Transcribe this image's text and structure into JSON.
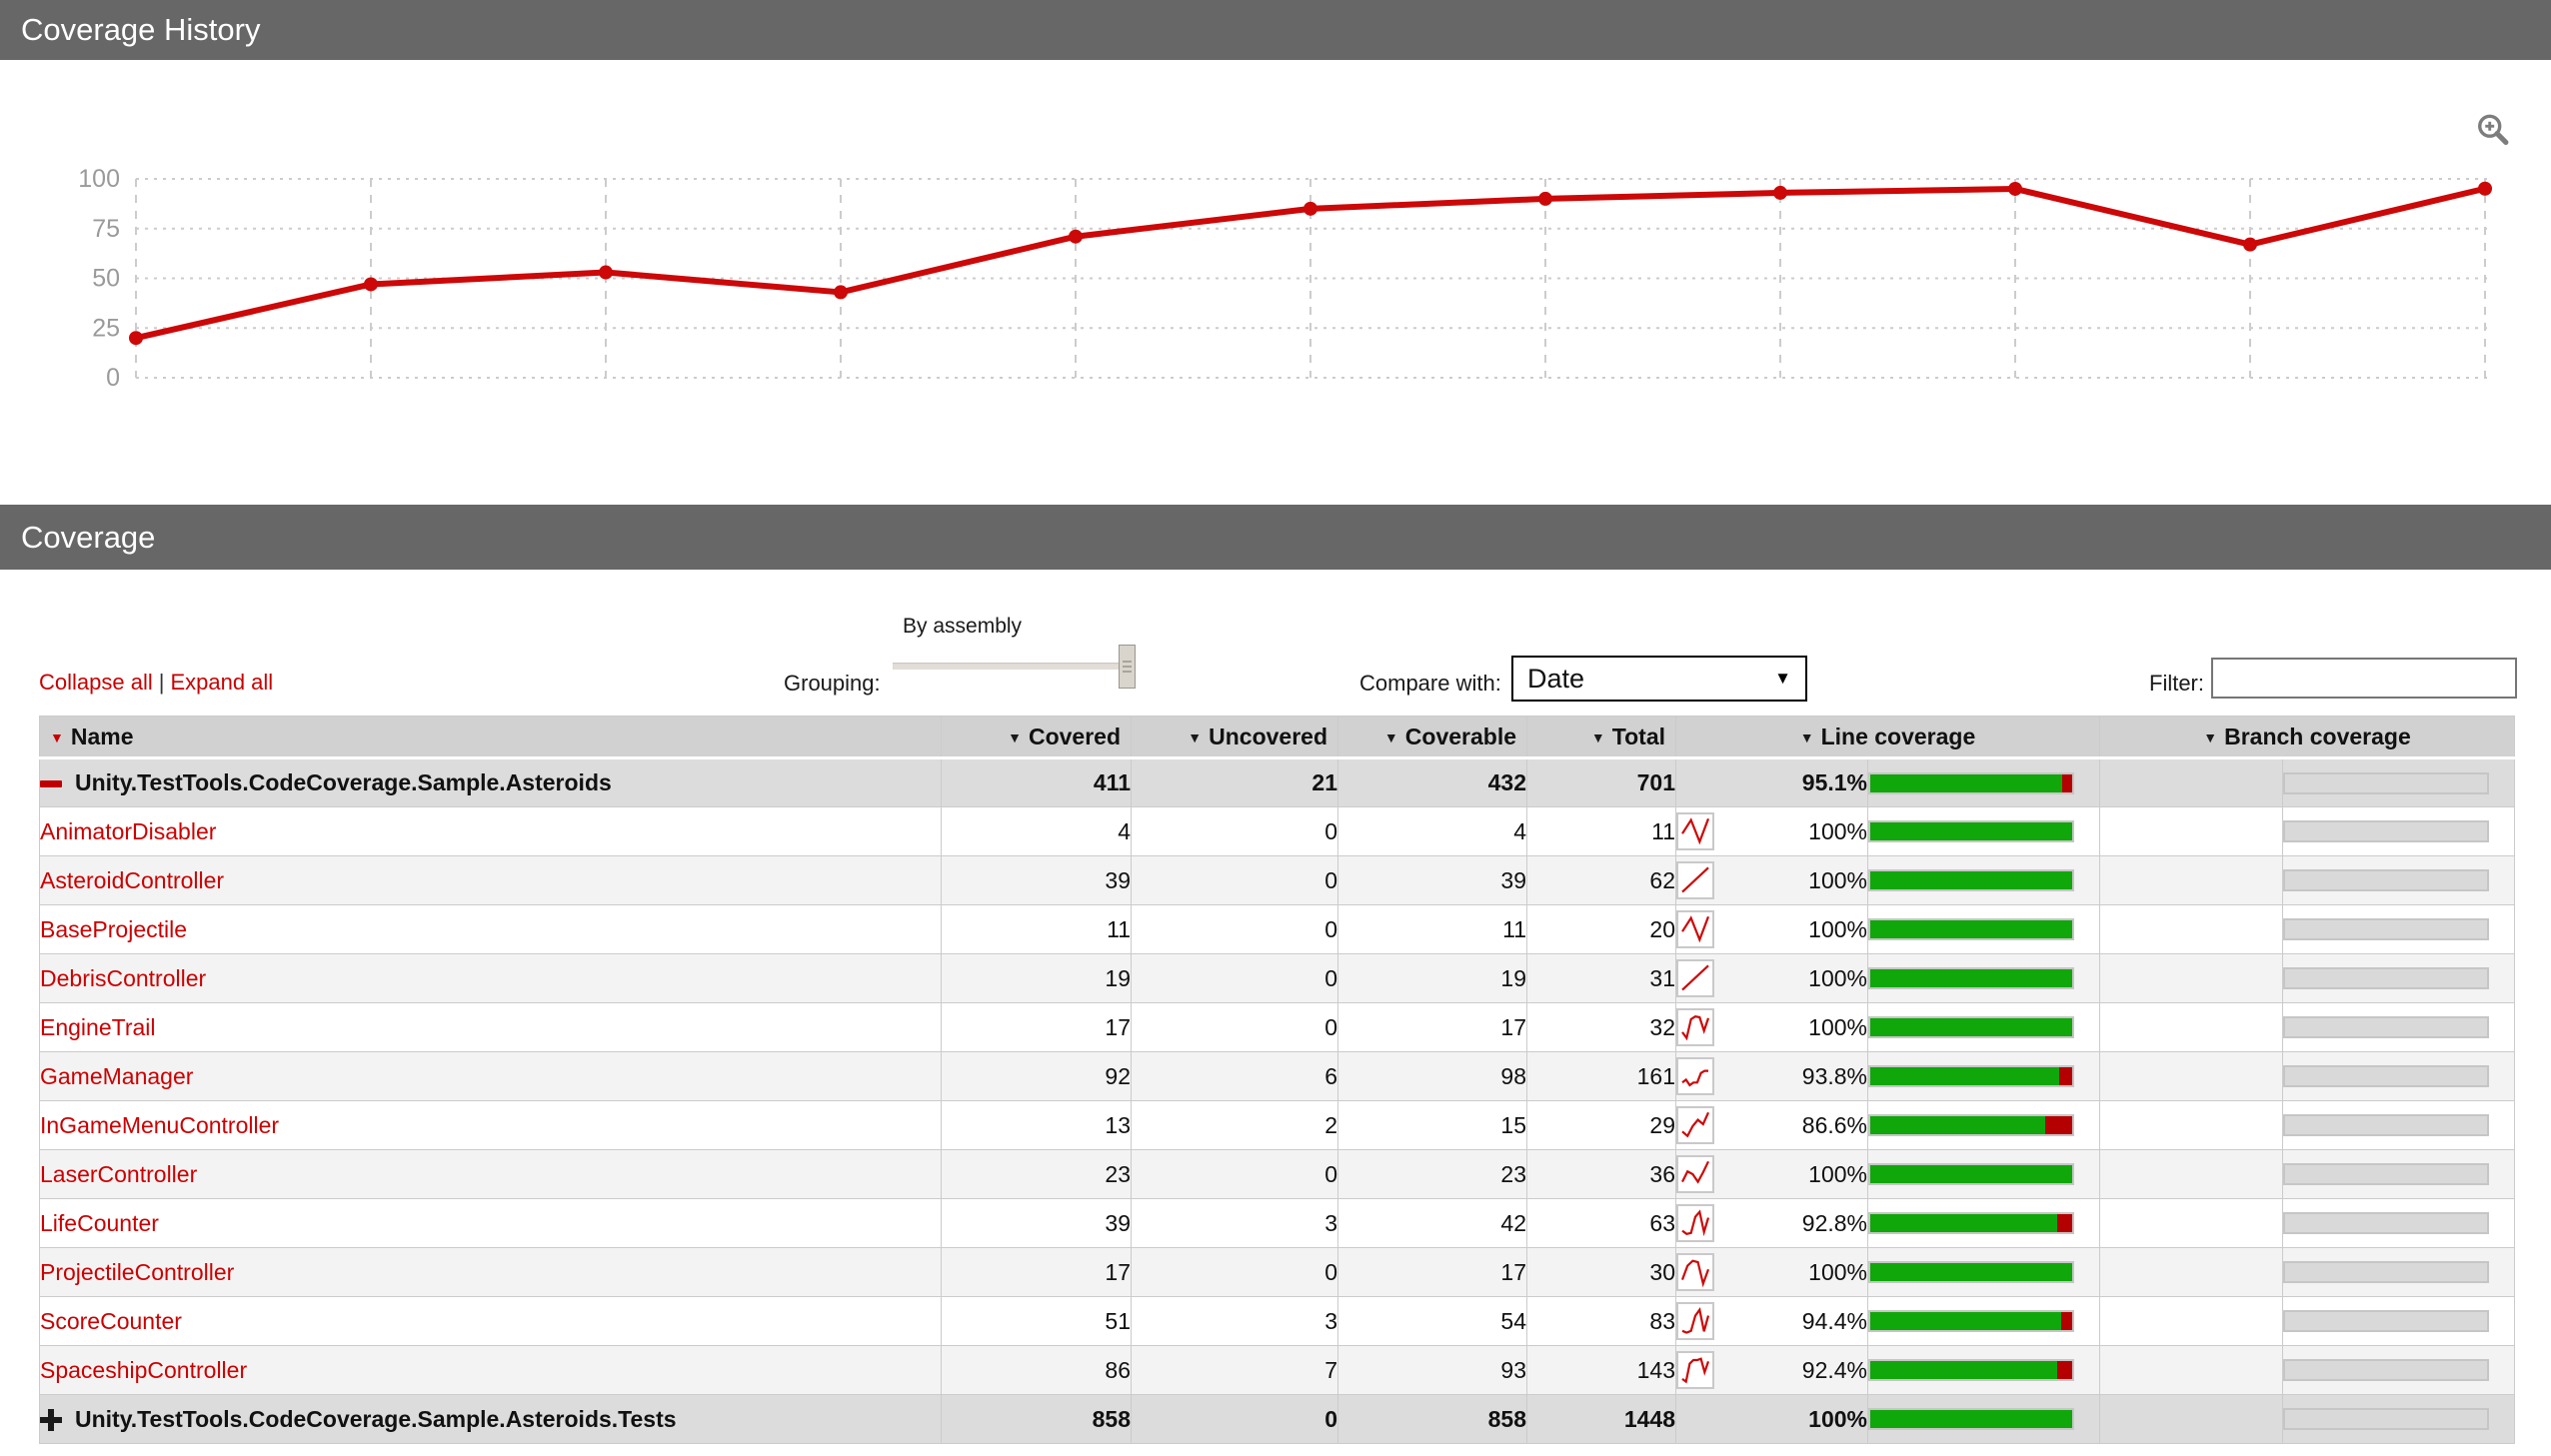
{
  "headers": {
    "history_title": "Coverage History",
    "coverage_title": "Coverage"
  },
  "chart_data": {
    "type": "line",
    "title": "Coverage History",
    "x": [
      1,
      2,
      3,
      4,
      5,
      6,
      7,
      8,
      9,
      10,
      11
    ],
    "series": [
      {
        "name": "Line coverage %",
        "values": [
          20,
          47,
          53,
          43,
          71,
          85,
          90,
          93,
          95,
          67,
          95.1
        ]
      }
    ],
    "ylim": [
      0,
      100
    ],
    "yticks": [
      "0",
      "25",
      "50",
      "75",
      "100"
    ],
    "grid": true,
    "legend": "none"
  },
  "icons": {
    "zoom": "magnifier-plus-icon",
    "collapse": "minus-icon",
    "expand": "plus-icon",
    "sort": "triangle-down-icon",
    "select_arrow": "triangle-down-icon"
  },
  "colors": {
    "header_gray": "#676767",
    "accent_red": "#cc0000",
    "chart_line": "#cc0808",
    "bar_green": "#10a70a",
    "bar_red": "#b40000",
    "branch_fill": "#d9d9d9",
    "grid_line": "#cccccc",
    "axis_label": "#9a9a9a"
  },
  "controls": {
    "collapse_all": "Collapse all",
    "separator": "|",
    "expand_all": "Expand all",
    "grouping_label": "Grouping:",
    "grouping_value": "By assembly",
    "compare_label": "Compare with:",
    "compare_value": "Date",
    "select_arrow": "▼",
    "filter_label": "Filter:",
    "filter_value": ""
  },
  "table": {
    "headers": [
      "Name",
      "Covered",
      "Uncovered",
      "Coverable",
      "Total",
      "Line coverage",
      "Branch coverage"
    ],
    "rows": [
      {
        "type": "assembly",
        "icon": "minus",
        "name": "Unity.TestTools.CodeCoverage.Sample.Asteroids",
        "covered": "411",
        "uncovered": "21",
        "coverable": "432",
        "total": "701",
        "line_pct": "95.1%",
        "pct": 95.1,
        "spark": null,
        "branch_pct": ""
      },
      {
        "type": "class",
        "name": "AnimatorDisabler",
        "covered": "4",
        "uncovered": "0",
        "coverable": "4",
        "total": "11",
        "line_pct": "100%",
        "pct": 100,
        "spark": [
          40,
          90,
          10,
          95
        ],
        "branch_pct": ""
      },
      {
        "type": "class",
        "name": "AsteroidController",
        "covered": "39",
        "uncovered": "0",
        "coverable": "39",
        "total": "62",
        "line_pct": "100%",
        "pct": 100,
        "spark": [
          5,
          95
        ],
        "branch_pct": ""
      },
      {
        "type": "class",
        "name": "BaseProjectile",
        "covered": "11",
        "uncovered": "0",
        "coverable": "11",
        "total": "20",
        "line_pct": "100%",
        "pct": 100,
        "spark": [
          40,
          90,
          10,
          95
        ],
        "branch_pct": ""
      },
      {
        "type": "class",
        "name": "DebrisController",
        "covered": "19",
        "uncovered": "0",
        "coverable": "19",
        "total": "31",
        "line_pct": "100%",
        "pct": 100,
        "spark": [
          5,
          95
        ],
        "branch_pct": ""
      },
      {
        "type": "class",
        "name": "EngineTrail",
        "covered": "17",
        "uncovered": "0",
        "coverable": "17",
        "total": "32",
        "line_pct": "100%",
        "pct": 100,
        "spark": [
          30,
          8,
          78,
          88,
          85,
          35,
          82
        ],
        "branch_pct": ""
      },
      {
        "type": "class",
        "name": "GameManager",
        "covered": "92",
        "uncovered": "6",
        "coverable": "98",
        "total": "161",
        "line_pct": "93.8%",
        "pct": 93.8,
        "spark": [
          25,
          35,
          15,
          25,
          25,
          60,
          68,
          68
        ],
        "branch_pct": ""
      },
      {
        "type": "class",
        "name": "InGameMenuController",
        "covered": "13",
        "uncovered": "2",
        "coverable": "15",
        "total": "29",
        "line_pct": "86.6%",
        "pct": 86.6,
        "spark": [
          25,
          8,
          45,
          68,
          52,
          95
        ],
        "branch_pct": ""
      },
      {
        "type": "class",
        "name": "LaserController",
        "covered": "23",
        "uncovered": "0",
        "coverable": "23",
        "total": "36",
        "line_pct": "100%",
        "pct": 100,
        "spark": [
          20,
          58,
          48,
          20,
          55,
          95
        ],
        "branch_pct": ""
      },
      {
        "type": "class",
        "name": "LifeCounter",
        "covered": "39",
        "uncovered": "3",
        "coverable": "42",
        "total": "63",
        "line_pct": "92.8%",
        "pct": 92.8,
        "spark": [
          20,
          8,
          12,
          72,
          90,
          15,
          68
        ],
        "branch_pct": ""
      },
      {
        "type": "class",
        "name": "ProjectileController",
        "covered": "17",
        "uncovered": "0",
        "coverable": "17",
        "total": "30",
        "line_pct": "100%",
        "pct": 100,
        "spark": [
          20,
          72,
          90,
          85,
          5,
          58
        ],
        "branch_pct": ""
      },
      {
        "type": "class",
        "name": "ScoreCounter",
        "covered": "51",
        "uncovered": "3",
        "coverable": "54",
        "total": "83",
        "line_pct": "94.4%",
        "pct": 94.4,
        "spark": [
          12,
          5,
          12,
          68,
          90,
          10,
          68
        ],
        "branch_pct": ""
      },
      {
        "type": "class",
        "name": "SpaceshipController",
        "covered": "86",
        "uncovered": "7",
        "coverable": "93",
        "total": "143",
        "line_pct": "92.4%",
        "pct": 92.4,
        "spark": [
          15,
          5,
          72,
          85,
          85,
          90,
          40,
          80
        ],
        "branch_pct": ""
      },
      {
        "type": "assembly",
        "icon": "plus",
        "name": "Unity.TestTools.CodeCoverage.Sample.Asteroids.Tests",
        "covered": "858",
        "uncovered": "0",
        "coverable": "858",
        "total": "1448",
        "line_pct": "100%",
        "pct": 100,
        "spark": null,
        "branch_pct": ""
      }
    ]
  }
}
